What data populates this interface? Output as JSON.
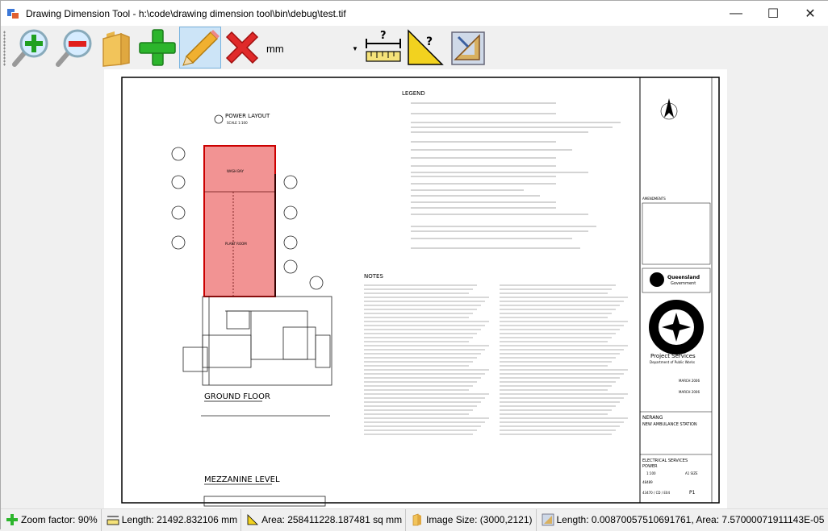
{
  "window": {
    "title": "Drawing Dimension Tool - h:\\code\\drawing dimension tool\\bin\\debug\\test.tif",
    "min_glyph": "—",
    "max_glyph": "☐",
    "close_glyph": "✕"
  },
  "toolbar": {
    "buttons": [
      {
        "name": "zoom-in-button",
        "icon": "zoom-in-icon"
      },
      {
        "name": "zoom-out-button",
        "icon": "zoom-out-icon"
      },
      {
        "name": "open-button",
        "icon": "folder-icon"
      },
      {
        "name": "add-button",
        "icon": "plus-icon"
      },
      {
        "name": "draw-button",
        "icon": "pencil-icon",
        "active": true
      },
      {
        "name": "delete-button",
        "icon": "x-icon"
      },
      {
        "name": "measure-length-button",
        "icon": "ruler-icon"
      },
      {
        "name": "measure-area-button",
        "icon": "triangle-icon"
      },
      {
        "name": "calibrate-button",
        "icon": "drafting-icon"
      }
    ],
    "unit_value": "mm",
    "ruler_label": "?",
    "triangle_label": "?"
  },
  "drawing": {
    "power_layout_title": "POWER LAYOUT",
    "power_layout_scale": "SCALE 1:100",
    "ground_floor_label": "GROUND FLOOR",
    "mezzanine_label": "MEZZANINE LEVEL",
    "legend_title": "LEGEND",
    "notes_title": "NOTES",
    "wash_bay": "WASH BAY",
    "plant_room": "PLANT ROOM",
    "queensland": "Queensland",
    "government": "Government",
    "project_services": "Project Services",
    "dept": "Department of Public Works",
    "nerang": "NERANG",
    "new_station": "NEW AMBULANCE STATION",
    "elec_services": "ELECTRICAL SERVICES",
    "power": "POWER",
    "drawing_no": "43470 / CD / E04",
    "sheet_rev": "P1",
    "scale_text": "1:100",
    "size_text": "A1 SIZE",
    "job_no": "48489",
    "march_a": "MARCH 2006",
    "march_b": "MARCH 2006",
    "amendments": "AMENDMENTS",
    "highlight_color": "#f08080"
  },
  "status": {
    "zoom": "Zoom factor: 90%",
    "length": "Length: 21492.832106 mm",
    "area": "Area: 258411228.187481 sq mm",
    "image_size": "Image Size: (3000,2121)",
    "calibration": "Length: 0.00870057510691761, Area: 7.57000071911143E-05"
  }
}
